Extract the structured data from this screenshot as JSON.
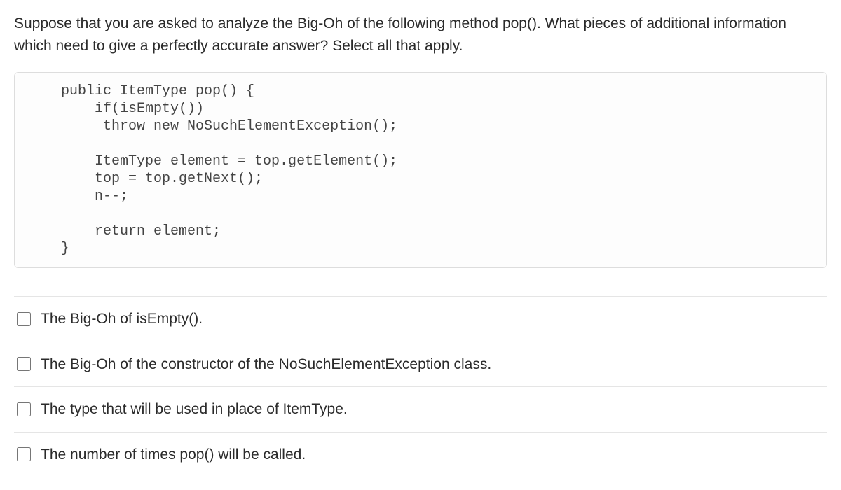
{
  "question": "Suppose that you are asked to analyze the Big-Oh of the following method pop(). What pieces of additional information which need to give a perfectly accurate answer? Select all that apply.",
  "code": "    public ItemType pop() {\n        if(isEmpty())\n         throw new NoSuchElementException();\n\n        ItemType element = top.getElement();\n        top = top.getNext();\n        n--;\n\n        return element;\n    }",
  "options": [
    {
      "label": "The Big-Oh of isEmpty()."
    },
    {
      "label": "The Big-Oh of the constructor of the NoSuchElementException class."
    },
    {
      "label": "The type that will be used in place of ItemType."
    },
    {
      "label": "The number of times pop() will be called."
    }
  ]
}
